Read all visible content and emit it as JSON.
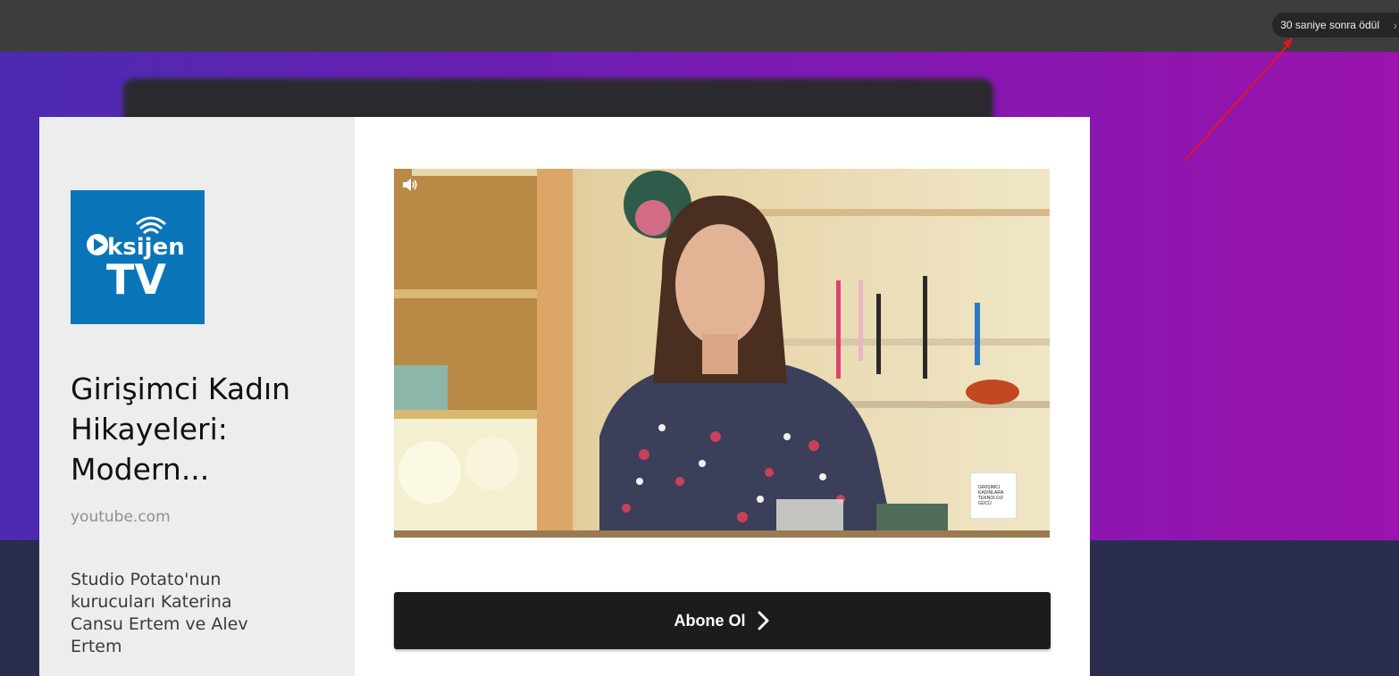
{
  "topbar": {
    "reward_text": "30 saniye sonra ödül",
    "reward_chevron": "›"
  },
  "ad": {
    "advertiser_logo": {
      "icon": "oksijen-tv-logo",
      "text_line1": "ksijen",
      "text_line2": "TV",
      "bg_color": "#0a75b8"
    },
    "headline": "Girişimci Kadın Hikayeleri: Modern...",
    "domain": "youtube.com",
    "description": "Studio Potato'nun kurucuları Katerina Cansu Ertem ve Alev Ertem",
    "video": {
      "volume_icon": "speaker-icon",
      "watermark_lines": [
        "GIRIŞIMCI",
        "KADINLARA",
        "TEKNOLOJİ",
        "GÜCÜ"
      ]
    },
    "cta_label": "Abone Ol",
    "cta_icon": "chevron-right-icon"
  },
  "colors": {
    "annotation_arrow": "#e8141c",
    "bg_purple_left": "#4b2bb0",
    "bg_purple_right": "#9a14ad",
    "cta_bg": "#1c1c1c"
  }
}
